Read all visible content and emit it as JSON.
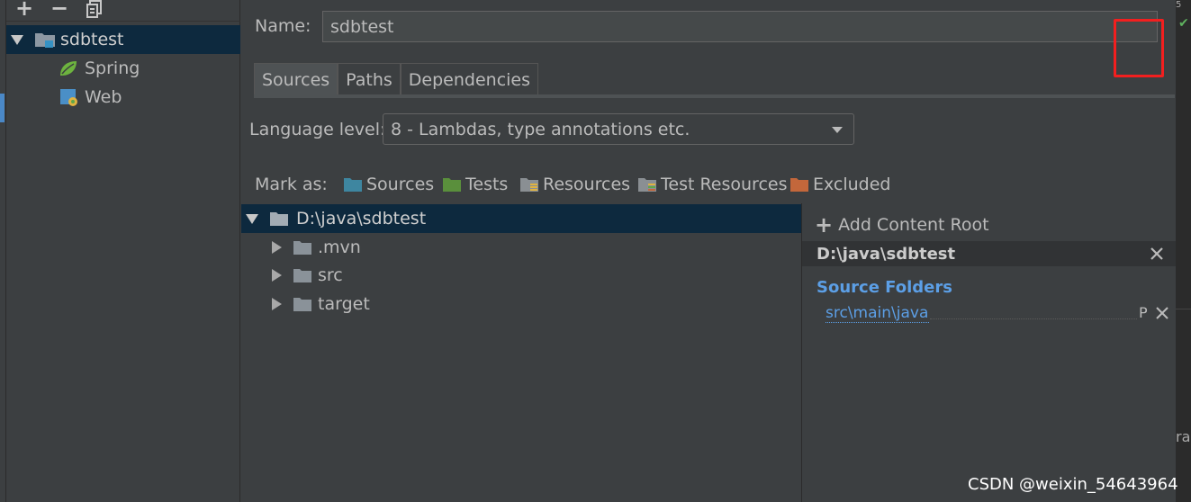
{
  "module_tree": {
    "toolbar": {
      "add": "+",
      "remove": "−"
    },
    "items": [
      {
        "label": "sdbtest",
        "icon": "module-folder-icon",
        "expanded": true,
        "selected": true
      },
      {
        "label": "Spring",
        "icon": "spring-leaf-icon"
      },
      {
        "label": "Web",
        "icon": "web-module-icon"
      }
    ]
  },
  "main": {
    "name_label": "Name:",
    "name_value": "sdbtest",
    "tabs": [
      {
        "label": "Sources",
        "active": true
      },
      {
        "label": "Paths"
      },
      {
        "label": "Dependencies"
      }
    ],
    "language_level_label": "Language level:",
    "language_level_value": "8 - Lambdas, type annotations etc.",
    "mark_as_label": "Mark as:",
    "mark_as": [
      {
        "label": "Sources",
        "color": "#3e86a0"
      },
      {
        "label": "Tests",
        "color": "#5a8f3c"
      },
      {
        "label": "Resources",
        "color": "#8a8f93"
      },
      {
        "label": "Test Resources",
        "color": "#8a8f93"
      },
      {
        "label": "Excluded",
        "color": "#c3673b"
      }
    ],
    "file_tree": {
      "root": "D:\\java\\sdbtest",
      "children": [
        ".mvn",
        "src",
        "target"
      ]
    },
    "content_root_panel": {
      "add_label": "Add Content Root",
      "root_path": "D:\\java\\sdbtest",
      "source_folders_title": "Source Folders",
      "source_folders": [
        "src\\main\\java"
      ],
      "package_prefix_glyph": "P"
    }
  },
  "right_strip": {
    "top": "5",
    "bottom_text": "rag"
  },
  "watermark": "CSDN @weixin_54643964"
}
